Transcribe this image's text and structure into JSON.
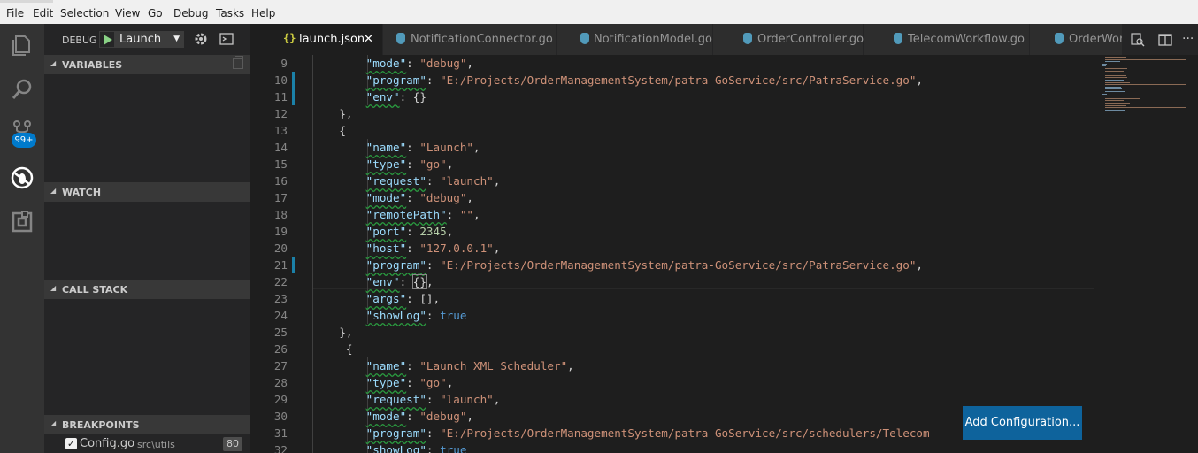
{
  "menu": [
    "File",
    "Edit",
    "Selection",
    "View",
    "Go",
    "Debug",
    "Tasks",
    "Help"
  ],
  "activity": {
    "badge": "99+"
  },
  "sidebar": {
    "title": "DEBUG",
    "config_select": "Launch",
    "sections": {
      "variables": "VARIABLES",
      "watch": "WATCH",
      "call_stack": "CALL STACK",
      "breakpoints": "BREAKPOINTS"
    },
    "breakpoint": {
      "file": "Config.go",
      "path": "src\\utils",
      "line": "80",
      "checked": true
    }
  },
  "tabs": [
    {
      "label": "launch.json",
      "icon": "json-icon",
      "active": true
    },
    {
      "label": "NotificationConnector.go",
      "icon": "go-icon",
      "active": false
    },
    {
      "label": "NotificationModel.go",
      "icon": "go-icon",
      "active": false
    },
    {
      "label": "OrderController.go",
      "icon": "go-icon",
      "active": false
    },
    {
      "label": "TelecomWorkflow.go",
      "icon": "go-icon",
      "active": false
    },
    {
      "label": "OrderWorl",
      "icon": "go-icon",
      "active": false
    }
  ],
  "editor": {
    "line_numbers": [
      "9",
      "10",
      "11",
      "12",
      "13",
      "14",
      "15",
      "16",
      "17",
      "18",
      "19",
      "20",
      "21",
      "22",
      "23",
      "24",
      "25",
      "26",
      "27",
      "28",
      "29",
      "30",
      "31",
      "32"
    ],
    "lines": [
      {
        "indent": "        ",
        "key": "\"mode\"",
        "sep": ": ",
        "val": "\"debug\"",
        "vtype": "s",
        "tail": ","
      },
      {
        "indent": "        ",
        "key": "\"program\"",
        "sep": ": ",
        "val": "\"E:/Projects/OrderManagementSystem/patra-GoService/src/PatraService.go\"",
        "vtype": "s",
        "tail": ","
      },
      {
        "indent": "        ",
        "key": "\"env\"",
        "sep": ": ",
        "val": "{}",
        "vtype": "p",
        "tail": ""
      },
      {
        "indent": "    ",
        "key": "",
        "sep": "",
        "val": "},",
        "vtype": "p",
        "tail": ""
      },
      {
        "indent": "    ",
        "key": "",
        "sep": "",
        "val": "{",
        "vtype": "p",
        "tail": ""
      },
      {
        "indent": "        ",
        "key": "\"name\"",
        "sep": ": ",
        "val": "\"Launch\"",
        "vtype": "s",
        "tail": ","
      },
      {
        "indent": "        ",
        "key": "\"type\"",
        "sep": ": ",
        "val": "\"go\"",
        "vtype": "s",
        "tail": ","
      },
      {
        "indent": "        ",
        "key": "\"request\"",
        "sep": ": ",
        "val": "\"launch\"",
        "vtype": "s",
        "tail": ","
      },
      {
        "indent": "        ",
        "key": "\"mode\"",
        "sep": ": ",
        "val": "\"debug\"",
        "vtype": "s",
        "tail": ","
      },
      {
        "indent": "        ",
        "key": "\"remotePath\"",
        "sep": ": ",
        "val": "\"\"",
        "vtype": "s",
        "tail": ","
      },
      {
        "indent": "        ",
        "key": "\"port\"",
        "sep": ": ",
        "val": "2345",
        "vtype": "n",
        "tail": ","
      },
      {
        "indent": "        ",
        "key": "\"host\"",
        "sep": ": ",
        "val": "\"127.0.0.1\"",
        "vtype": "s",
        "tail": ","
      },
      {
        "indent": "        ",
        "key": "\"program\"",
        "sep": ": ",
        "val": "\"E:/Projects/OrderManagementSystem/patra-GoService/src/PatraService.go\"",
        "vtype": "s",
        "tail": ","
      },
      {
        "indent": "        ",
        "key": "\"env\"",
        "sep": ": ",
        "val": "{}",
        "vtype": "p",
        "tail": ","
      },
      {
        "indent": "        ",
        "key": "\"args\"",
        "sep": ": ",
        "val": "[]",
        "vtype": "p",
        "tail": ","
      },
      {
        "indent": "        ",
        "key": "\"showLog\"",
        "sep": ": ",
        "val": "true",
        "vtype": "b",
        "tail": ""
      },
      {
        "indent": "    ",
        "key": "",
        "sep": "",
        "val": "},",
        "vtype": "p",
        "tail": ""
      },
      {
        "indent": "     ",
        "key": "",
        "sep": "",
        "val": "{",
        "vtype": "p",
        "tail": ""
      },
      {
        "indent": "        ",
        "key": "\"name\"",
        "sep": ": ",
        "val": "\"Launch XML Scheduler\"",
        "vtype": "s",
        "tail": ","
      },
      {
        "indent": "        ",
        "key": "\"type\"",
        "sep": ": ",
        "val": "\"go\"",
        "vtype": "s",
        "tail": ","
      },
      {
        "indent": "        ",
        "key": "\"request\"",
        "sep": ": ",
        "val": "\"launch\"",
        "vtype": "s",
        "tail": ","
      },
      {
        "indent": "        ",
        "key": "\"mode\"",
        "sep": ": ",
        "val": "\"debug\"",
        "vtype": "s",
        "tail": ","
      },
      {
        "indent": "        ",
        "key": "\"program\"",
        "sep": ": ",
        "val": "\"E:/Projects/OrderManagementSystem/patra-GoService/src/schedulers/Telecom",
        "vtype": "s",
        "tail": ""
      },
      {
        "indent": "        ",
        "key": "\"showLog\"",
        "sep": ": ",
        "val": "true",
        "vtype": "b",
        "tail": ""
      }
    ]
  },
  "add_configuration": "Add Configuration...",
  "colors": {
    "accent": "#007acc",
    "button": "#0e639c",
    "string": "#ce9178",
    "key": "#9cdcfe"
  }
}
